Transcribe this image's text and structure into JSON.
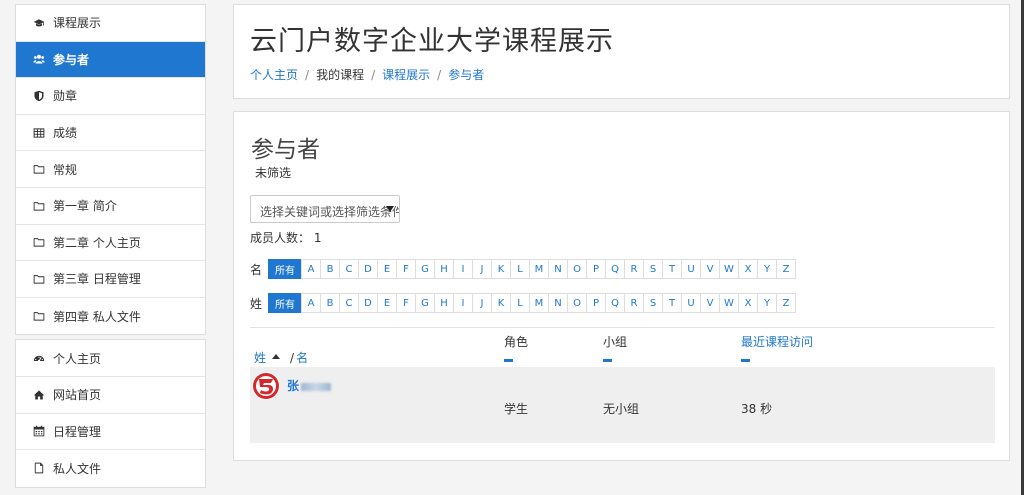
{
  "sidebar": {
    "course_items": [
      {
        "label": "课程展示",
        "icon": "graduation-cap-icon"
      },
      {
        "label": "参与者",
        "icon": "users-icon",
        "active": true
      },
      {
        "label": "勋章",
        "icon": "shield-icon"
      },
      {
        "label": "成绩",
        "icon": "table-icon"
      },
      {
        "label": "常规",
        "icon": "folder-icon"
      },
      {
        "label": "第一章 简介",
        "icon": "folder-icon"
      },
      {
        "label": "第二章 个人主页",
        "icon": "folder-icon"
      },
      {
        "label": "第三章 日程管理",
        "icon": "folder-icon"
      },
      {
        "label": "第四章 私人文件",
        "icon": "folder-icon"
      }
    ],
    "site_items": [
      {
        "label": "个人主页",
        "icon": "dashboard-icon"
      },
      {
        "label": "网站首页",
        "icon": "home-icon"
      },
      {
        "label": "日程管理",
        "icon": "calendar-icon"
      },
      {
        "label": "私人文件",
        "icon": "file-icon"
      }
    ]
  },
  "header": {
    "title": "云门户数字企业大学课程展示",
    "breadcrumb": [
      "个人主页",
      "我的课程",
      "课程展示",
      "参与者"
    ]
  },
  "main": {
    "section_title": "参与者",
    "filter_status": "未筛选",
    "filter_placeholder": "选择关键词或选择筛选条件",
    "member_count": "成员人数： 1",
    "first_name_label": "名",
    "last_name_label": "姓",
    "all_label": "所有",
    "letters": [
      "A",
      "B",
      "C",
      "D",
      "E",
      "F",
      "G",
      "H",
      "I",
      "J",
      "K",
      "L",
      "M",
      "N",
      "O",
      "P",
      "Q",
      "R",
      "S",
      "T",
      "U",
      "V",
      "W",
      "X",
      "Y",
      "Z"
    ],
    "table": {
      "col_last": "姓",
      "col_first": "名",
      "col_role": "角色",
      "col_group": "小组",
      "col_access": "最近课程访问",
      "rows": [
        {
          "name": "张",
          "role": "学生",
          "group": "无小组",
          "last_access": "38 秒"
        }
      ]
    }
  },
  "colors": {
    "accent": "#1f77cf",
    "avatar_red": "#d6282b"
  }
}
